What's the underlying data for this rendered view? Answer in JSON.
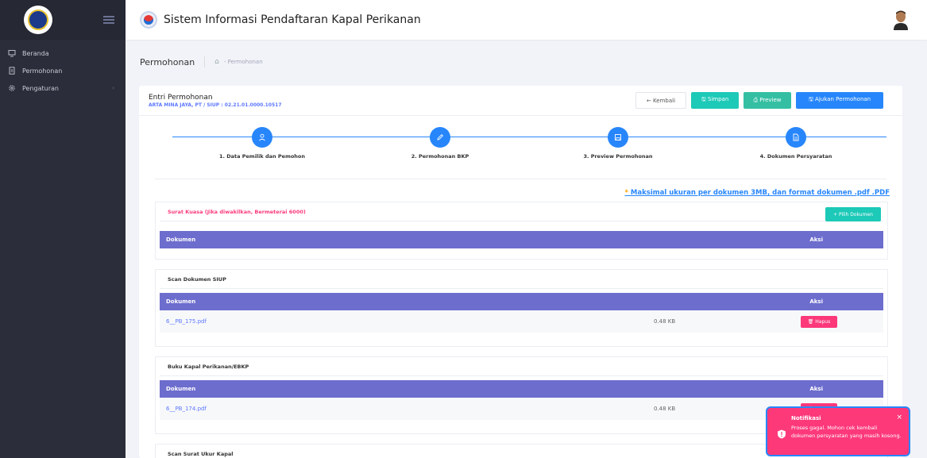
{
  "sidebar": {
    "items": [
      {
        "label": "Beranda",
        "icon": "monitor-icon"
      },
      {
        "label": "Permohonan",
        "icon": "document-icon"
      },
      {
        "label": "Pengaturan",
        "icon": "gear-icon"
      }
    ]
  },
  "header": {
    "title": "Sistem Informasi Pendaftaran Kapal Perikanan"
  },
  "subheader": {
    "title": "Permohonan",
    "breadcrumb": "- Permohonan"
  },
  "card": {
    "title": "Entri Permohonan",
    "subtitle": "ARTA MINA JAYA, PT / SIUP : 02.21.01.0000.10517",
    "actions": {
      "kembali": "← Kembali",
      "simpan": "🖫 Simpan",
      "preview": "⎙ Preview",
      "ajukan": "🖫 Ajukan Permohonan"
    }
  },
  "steps": [
    {
      "label": "1. Data Pemilik dan Pemohon",
      "icon": "user-icon"
    },
    {
      "label": "2. Permohonan BKP",
      "icon": "pencil-icon"
    },
    {
      "label": "3. Preview Permohonan",
      "icon": "save-icon"
    },
    {
      "label": "4. Dokumen Persyaratan",
      "icon": "file-icon"
    }
  ],
  "note": {
    "star": "*",
    "text": "Maksimal ukuran per dokumen 3MB, dan format dokumen .pdf .PDF"
  },
  "documents": [
    {
      "title": "Surat Kuasa (Jika diwakilkan, Bermeterai 6000)",
      "button": "+ Pilih Dokumen",
      "rows": []
    },
    {
      "title": "Scan Dokumen SIUP",
      "rows": [
        {
          "file": "6__PB_175.pdf",
          "size": "0.48 KB",
          "action": "🗑 Hapus"
        }
      ]
    },
    {
      "title": "Buku Kapal Perikanan/EBKP",
      "rows": [
        {
          "file": "6__PB_174.pdf",
          "size": "0.48 KB",
          "action": "🗑 Hapus"
        }
      ]
    },
    {
      "title": "Scan Surat Ukur Kapal",
      "rows": []
    }
  ],
  "table": {
    "col_dokumen": "Dokumen",
    "col_aksi": "Aksi"
  },
  "toast": {
    "title": "Notifikasi",
    "message": "Proses gagal. Mohon cek kembali dokumen persyaratan yang masih kosong.",
    "close": "×"
  },
  "colors": {
    "sidebar": "#2b2d3a",
    "primary": "#2786fb",
    "teal": "#1dc9b7",
    "table_head": "#6d6dce",
    "danger": "#fd397a"
  }
}
